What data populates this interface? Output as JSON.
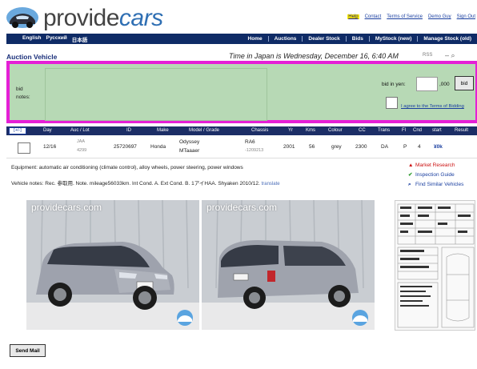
{
  "header": {
    "logo_text_a": "provide",
    "logo_text_b": "cars",
    "links": [
      "Help",
      "Contact",
      "Terms of Service",
      "Demo Guy",
      "Sign Out"
    ]
  },
  "nav": {
    "languages": [
      "English",
      "Русский",
      "日本語"
    ],
    "items": [
      "Home",
      "Auctions",
      "Dealer Stock",
      "Bids",
      "MyStock (new)",
      "Manage Stock (old)"
    ]
  },
  "page": {
    "title": "Auction Vehicle",
    "time_info": "Time in Japan is Wednesday, December 16, 6:40 AM",
    "rss": "RSS"
  },
  "bid": {
    "label_line1": "bid",
    "label_line2": "notes:",
    "yen_label": "bid in yen:",
    "input_value": "",
    "suffix": ",000",
    "button": "bid",
    "terms_text": "I agree to the Terms of Bidding"
  },
  "table": {
    "select_all": "[+/-]",
    "columns": [
      "Day",
      "Auc / Lot",
      "ID",
      "Make",
      "Model / Grade",
      "Chassis",
      "Yr",
      "Kms",
      "Colour",
      "CC",
      "Trans",
      "Fl",
      "Cnd",
      "start",
      "Result"
    ],
    "row": {
      "day": "12/16",
      "auc": "JAA",
      "lot": "4299",
      "id": "25720697",
      "make": "Honda",
      "model": "Odyssey",
      "grade": "MTaaaer",
      "chassis": "RA6",
      "chassis_no": "-1209213",
      "yr": "2001",
      "kms": "56",
      "colour": "grey",
      "cc": "2300",
      "trans": "DA",
      "fl": "P",
      "cnd": "4",
      "start": "¥0k",
      "result": ""
    }
  },
  "details": {
    "equipment": "Equipment: automatic air conditioning (climate control), alloy wheels, power steering, power windows",
    "notes": "Vehicle notes: Rec. 参取用. Note. mileage56033km. Int Cond. A. Ext Cond. B. 1アイHAA. Shyaken 2010/12.",
    "translate": "translate"
  },
  "side_links": {
    "market_research": "Market Research",
    "inspection_guide": "Inspection Guide",
    "similar": "Find Similar Vehicles"
  },
  "photos": {
    "watermark1": "providecars.com",
    "watermark2": "providecars.com"
  },
  "footer": {
    "send_mail": "Send Mail"
  },
  "colors": {
    "nav_bg": "#0f2b66",
    "bid_border": "#e51fd6",
    "bid_bg": "#b7d9b5",
    "link": "#1a3fa0",
    "help_bg": "#ffef00"
  }
}
